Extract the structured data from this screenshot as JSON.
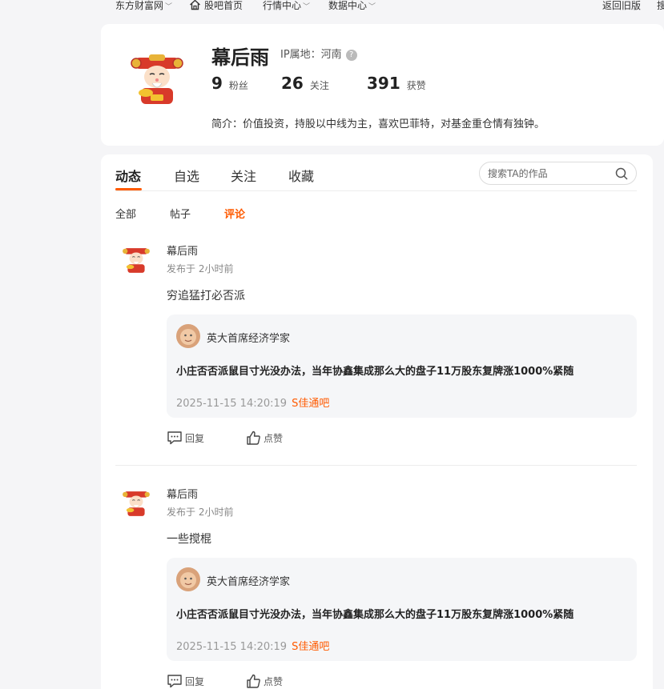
{
  "topnav": {
    "site": "东方财富网",
    "home": "股吧首页",
    "market": "行情中心",
    "data": "数据中心",
    "old_version": "返回旧版",
    "cut_right": "搜"
  },
  "profile": {
    "name": "幕后雨",
    "ip_label": "IP属地：河南",
    "fans_count": "9",
    "fans_label": "粉丝",
    "follow_count": "26",
    "follow_label": "关注",
    "likes_count": "391",
    "likes_label": "获赞",
    "bio": "简介：价值投资，持股以中线为主，喜欢巴菲特，对基金重仓情有独钟。"
  },
  "tabs": {
    "dynamic": "动态",
    "watchlist": "自选",
    "following": "关注",
    "favorites": "收藏"
  },
  "search": {
    "placeholder": "搜索TA的作品"
  },
  "subtabs": {
    "all": "全部",
    "posts": "帖子",
    "comments": "评论"
  },
  "posts": [
    {
      "author": "幕后雨",
      "time": "发布于 2小时前",
      "text": "穷追猛打必否派",
      "quote": {
        "author": "英大首席经济学家",
        "text": "小庄否否派鼠目寸光没办法，当年协鑫集成那么大的盘子11万股东复牌涨1000%紧随",
        "date": "2025-11-15 14:20:19",
        "bar": "S佳通吧"
      },
      "reply_label": "回复",
      "like_label": "点赞"
    },
    {
      "author": "幕后雨",
      "time": "发布于 2小时前",
      "text": "一些搅棍",
      "quote": {
        "author": "英大首席经济学家",
        "text": "小庄否否派鼠目寸光没办法，当年协鑫集成那么大的盘子11万股东复牌涨1000%紧随",
        "date": "2025-11-15 14:20:19",
        "bar": "S佳通吧"
      },
      "reply_label": "回复",
      "like_label": "点赞"
    }
  ],
  "colors": {
    "accent": "#ff5a00",
    "background": "#f5f5f7",
    "quote_bg": "#f5f6f8"
  }
}
